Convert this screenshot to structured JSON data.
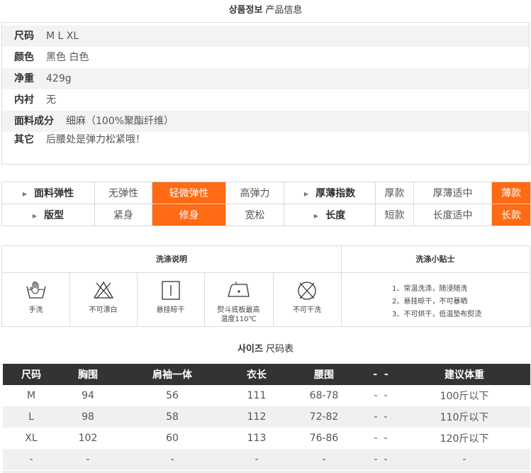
{
  "product_info": {
    "title_ko": "상품정보",
    "title_cn": "产品信息",
    "rows": [
      {
        "key": "尺码",
        "value": "M L XL"
      },
      {
        "key": "颜色",
        "value": "黑色 白色"
      },
      {
        "key": "净重",
        "value": "429g"
      },
      {
        "key": "内衬",
        "value": "无"
      },
      {
        "key": "面料成分",
        "value": "细麻（100%聚酯纤维）"
      },
      {
        "key": "其它",
        "value": "后腰处是弹力松紧哦！"
      }
    ]
  },
  "attributes": {
    "row1": {
      "label_a": "面料弹性",
      "opts_a": [
        "无弹性",
        "轻微弹性",
        "高弹力"
      ],
      "label_b": "厚薄指数",
      "opts_b": [
        "厚款",
        "厚薄适中",
        "薄款"
      ]
    },
    "row2": {
      "label_a": "版型",
      "opts_a": [
        "紧身",
        "修身",
        "宽松"
      ],
      "label_b": "长度",
      "opts_b": [
        "短款",
        "长度适中",
        "长款"
      ]
    },
    "highlight_color": "#ff6a13"
  },
  "washing": {
    "instructions_title": "洗涤说明",
    "tips_title": "洗涤小贴士",
    "icons": [
      {
        "name": "hand-wash-icon",
        "label": "手洗"
      },
      {
        "name": "no-bleach-icon",
        "label": "不可漂白"
      },
      {
        "name": "hang-dry-icon",
        "label": "悬挂晾干"
      },
      {
        "name": "iron-temp-icon",
        "label1": "熨斗底板最高",
        "label2": "温度110℃"
      },
      {
        "name": "no-dry-clean-icon",
        "label": "不可干洗"
      }
    ],
    "tips": [
      "1、常温洗涤，随浸随洗",
      "2、悬挂晾干，不可暴晒",
      "3、不可烘干，低温垫布熨烫"
    ]
  },
  "size_chart": {
    "title_ko": "사이즈",
    "title_cn": "尺码表",
    "headers": [
      "尺码",
      "胸围",
      "肩袖一体",
      "衣长",
      "腰围",
      "-  -",
      "建议体重"
    ],
    "rows": [
      [
        "M",
        "94",
        "56",
        "111",
        "68-78",
        "-  -",
        "100斤以下"
      ],
      [
        "L",
        "98",
        "58",
        "112",
        "72-82",
        "-  -",
        "110斤以下"
      ],
      [
        "XL",
        "102",
        "60",
        "113",
        "76-86",
        "-  -",
        "120斤以下"
      ],
      [
        "-",
        "-",
        "-",
        "-",
        "-",
        "-  -",
        "-"
      ]
    ]
  }
}
